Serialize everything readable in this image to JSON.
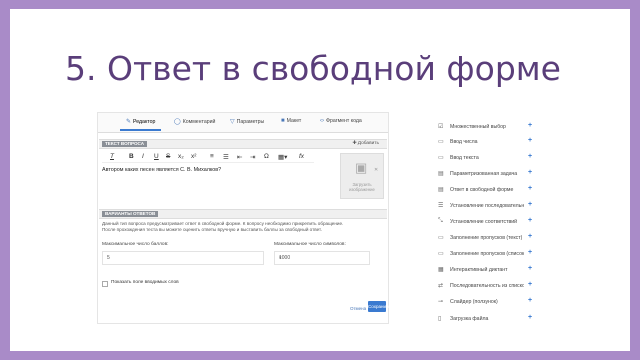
{
  "slide": {
    "title": "5. Ответ в свободной форме"
  },
  "tabs": [
    {
      "label": "Редактор",
      "icon": "edit-icon"
    },
    {
      "label": "Комментарий",
      "icon": "comment-icon"
    },
    {
      "label": "Параметры",
      "icon": "settings-icon"
    },
    {
      "label": "Макет",
      "icon": "layout-icon"
    },
    {
      "label": "Фрагмент кода",
      "icon": "code-icon"
    }
  ],
  "question_section": {
    "label": "ТЕКСТ ВОПРОСА",
    "add_label": "Добавить",
    "text": "Автором каких песен является С. В. Михалков?",
    "image_label": "Загрузить изображение",
    "toolbar_icons": [
      "clear-format-icon",
      "bold-icon",
      "italic-icon",
      "underline-icon",
      "strike-icon",
      "superscript-icon",
      "subscript-icon",
      "numbered-list-icon",
      "bullet-list-icon",
      "outdent-icon",
      "indent-icon",
      "special-char-icon",
      "table-icon",
      "formula-icon"
    ]
  },
  "answer_section": {
    "label": "ВАРИАНТЫ ОТВЕТОВ",
    "description_line1": "Данный тип вопроса предусматривает ответ в свободной форме. К вопросу необходимо прикрепить обращение.",
    "description_line2": "После прохождения теста вы можете оценить ответы вручную и выставить баллы за свободный ответ.",
    "max_score_label": "Максимальное число баллов:",
    "max_score_value": "5",
    "max_length_label": "Максимальное число символов:",
    "max_length_value": "1000",
    "checkbox_label": "Показать поле вводимых слов"
  },
  "footer": {
    "cancel_label": "Отмена",
    "save_label": "Сохранить"
  },
  "sidebar": {
    "items": [
      {
        "label": "Множественный выбор",
        "icon": "multi-choice-icon"
      },
      {
        "label": "Ввод числа",
        "icon": "number-input-icon"
      },
      {
        "label": "Ввод текста",
        "icon": "text-input-icon"
      },
      {
        "label": "Параметризованная задача",
        "icon": "param-task-icon"
      },
      {
        "label": "Ответ в свободной форме",
        "icon": "free-answer-icon"
      },
      {
        "label": "Установление последовательности",
        "icon": "sequence-icon"
      },
      {
        "label": "Установление соответствий",
        "icon": "matching-icon"
      },
      {
        "label": "Заполнение пропусков (текст)",
        "icon": "fill-text-icon"
      },
      {
        "label": "Заполнение пропусков (список)",
        "icon": "fill-list-icon"
      },
      {
        "label": "Интерактивный диктант",
        "icon": "dictation-icon"
      },
      {
        "label": "Последовательность из списков",
        "icon": "list-sequence-icon"
      },
      {
        "label": "Слайдер (ползунок)",
        "icon": "slider-icon"
      },
      {
        "label": "Загрузка файла",
        "icon": "file-upload-icon"
      }
    ]
  },
  "colors": {
    "frame": "#a98bc8",
    "title": "#5a3e7a",
    "accent": "#3a7ad0"
  }
}
